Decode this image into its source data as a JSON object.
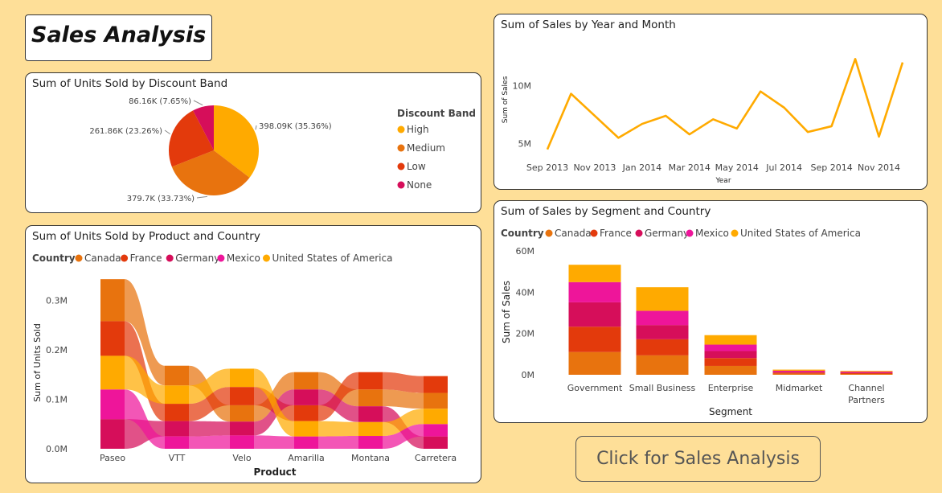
{
  "page_title": "Sales Analysis",
  "button_label": "Click for Sales Analysis",
  "palette": {
    "Canada": "#E8730E",
    "France": "#E33A0C",
    "Germany": "#D60E5A",
    "Mexico": "#EE159A",
    "United States of America": "#FFAA00"
  },
  "chart_data": [
    {
      "type": "pie",
      "title": "Sum of Units Sold by Discount Band",
      "legend_title": "Discount Band",
      "slices": [
        {
          "name": "High",
          "value": 398090,
          "label": "398.09K (35.36%)",
          "color": "#FFAA00"
        },
        {
          "name": "Medium",
          "value": 379700,
          "label": "379.7K (33.73%)",
          "color": "#E8730E"
        },
        {
          "name": "Low",
          "value": 261860,
          "label": "261.86K (23.26%)",
          "color": "#E33A0C"
        },
        {
          "name": "None",
          "value": 86160,
          "label": "86.16K (7.65%)",
          "color": "#D60E5A"
        }
      ]
    },
    {
      "type": "line",
      "title": "Sum of Sales by Year and Month",
      "xlabel": "Year",
      "ylabel": "Sum of Sales",
      "color": "#FFAA00",
      "x": [
        "Sep 2013",
        "Oct 2013",
        "Nov 2013",
        "Dec 2013",
        "Jan 2014",
        "Feb 2014",
        "Mar 2014",
        "Apr 2014",
        "May 2014",
        "Jun 2014",
        "Jul 2014",
        "Aug 2014",
        "Sep 2014",
        "Oct 2014",
        "Nov 2014",
        "Dec 2014"
      ],
      "y": [
        4.5,
        9.3,
        7.4,
        5.5,
        6.7,
        7.4,
        5.8,
        7.1,
        6.3,
        9.5,
        8.1,
        6.0,
        6.5,
        12.3,
        5.6,
        12.0
      ],
      "x_ticks": [
        "Sep 2013",
        "Nov 2013",
        "Jan 2014",
        "Mar 2014",
        "May 2014",
        "Jul 2014",
        "Sep 2014",
        "Nov 2014"
      ],
      "y_ticks": [
        {
          "value": 5,
          "label": "5M"
        },
        {
          "value": 10,
          "label": "10M"
        }
      ],
      "ylim": [
        4,
        13.5
      ]
    },
    {
      "type": "ribbon",
      "title": "Sum of Units Sold by Product and Country",
      "xlabel": "Product",
      "ylabel": "Sum of Units Sold",
      "legend_title": "Country",
      "countries": [
        "Canada",
        "France",
        "Germany",
        "Mexico",
        "United States of America"
      ],
      "categories": [
        "Paseo",
        "VTT",
        "Velo",
        "Amarilla",
        "Montana",
        "Carretera"
      ],
      "values": {
        "Paseo": {
          "Canada": 0.085,
          "France": 0.07,
          "Germany": 0.06,
          "Mexico": 0.06,
          "United States of America": 0.068
        },
        "VTT": {
          "Canada": 0.04,
          "France": 0.035,
          "Germany": 0.031,
          "Mexico": 0.025,
          "United States of America": 0.037
        },
        "Velo": {
          "Canada": 0.033,
          "France": 0.037,
          "Germany": 0.028,
          "Mexico": 0.027,
          "United States of America": 0.037
        },
        "Amarilla": {
          "Canada": 0.035,
          "France": 0.032,
          "Germany": 0.032,
          "Mexico": 0.025,
          "United States of America": 0.031
        },
        "Montana": {
          "Canada": 0.034,
          "France": 0.035,
          "Germany": 0.032,
          "Mexico": 0.026,
          "United States of America": 0.028
        },
        "Carretera": {
          "Canada": 0.032,
          "France": 0.034,
          "Germany": 0.025,
          "Mexico": 0.025,
          "United States of America": 0.031
        }
      },
      "y_ticks": [
        {
          "value": 0.0,
          "label": "0.0M"
        },
        {
          "value": 0.1,
          "label": "0.1M"
        },
        {
          "value": 0.2,
          "label": "0.2M"
        },
        {
          "value": 0.3,
          "label": "0.3M"
        }
      ],
      "ylim": [
        0,
        0.34
      ]
    },
    {
      "type": "bar",
      "stacked": true,
      "title": "Sum of Sales by Segment and Country",
      "xlabel": "Segment",
      "ylabel": "Sum of Sales",
      "legend_title": "Country",
      "categories": [
        "Government",
        "Small Business",
        "Enterprise",
        "Midmarket",
        "Channel Partners"
      ],
      "series": [
        {
          "name": "Canada",
          "values": [
            11,
            9.4,
            4.3,
            0.55,
            0.4
          ]
        },
        {
          "name": "France",
          "values": [
            12.3,
            7.8,
            3.8,
            0.5,
            0.4
          ]
        },
        {
          "name": "Germany",
          "values": [
            11.8,
            6.9,
            3.4,
            0.45,
            0.35
          ]
        },
        {
          "name": "Mexico",
          "values": [
            9.8,
            6.9,
            3.1,
            0.45,
            0.35
          ]
        },
        {
          "name": "United States of America",
          "values": [
            8.4,
            11.4,
            4.6,
            0.55,
            0.4
          ]
        }
      ],
      "y_ticks": [
        {
          "value": 0,
          "label": "0M"
        },
        {
          "value": 20,
          "label": "20M"
        },
        {
          "value": 40,
          "label": "40M"
        },
        {
          "value": 60,
          "label": "60M"
        }
      ],
      "ylim": [
        0,
        60
      ]
    }
  ]
}
